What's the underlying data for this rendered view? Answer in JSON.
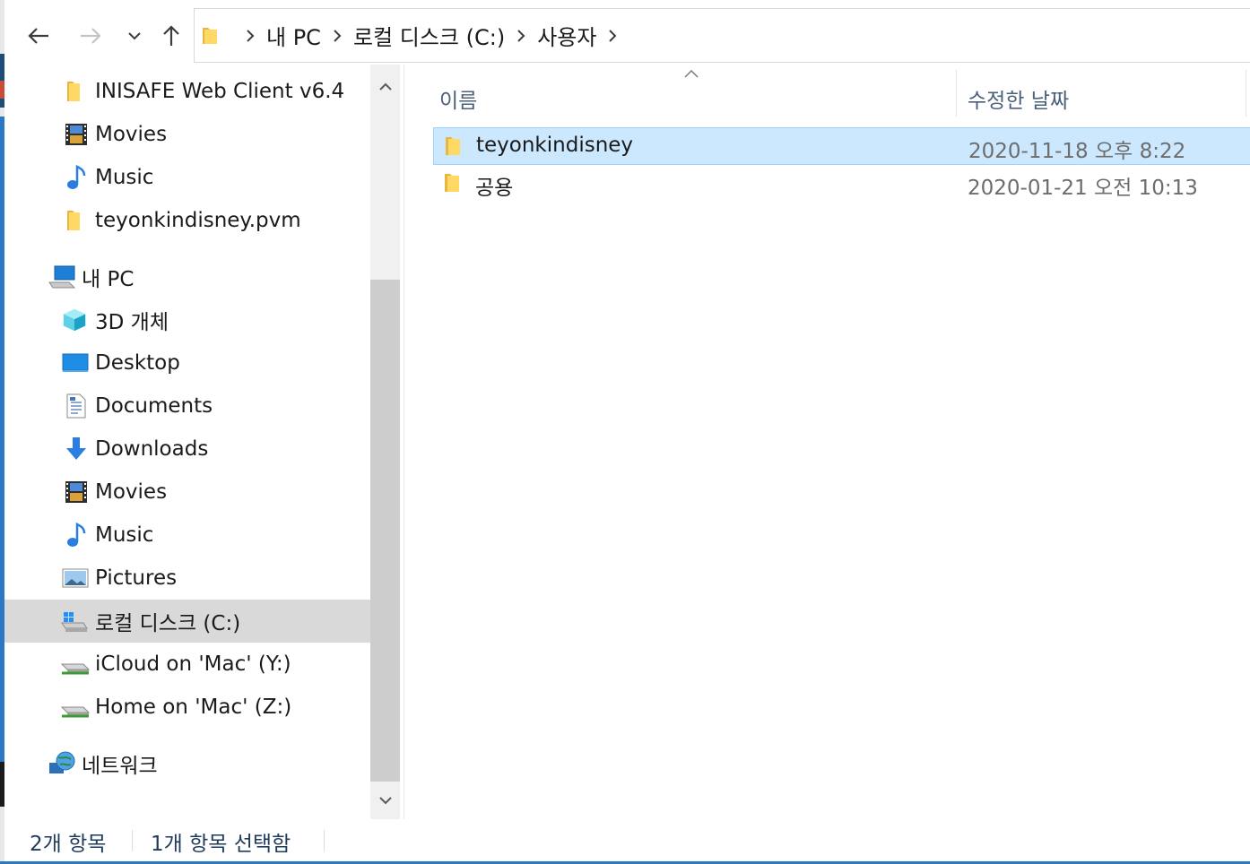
{
  "window": {
    "accent_color": "#2a78c6",
    "selection_color": "#cce8ff"
  },
  "toolbar": {
    "back_icon": "back-arrow-icon",
    "forward_icon": "forward-arrow-icon",
    "recent_icon": "chevron-down-icon",
    "up_icon": "up-arrow-icon"
  },
  "address": {
    "crumbs": [
      "내 PC",
      "로컬 디스크 (C:)",
      "사용자"
    ]
  },
  "nav_pane": {
    "items": [
      {
        "label": "INISAFE Web Client v6.4",
        "icon": "folder-icon"
      },
      {
        "label": "Movies",
        "icon": "film-icon"
      },
      {
        "label": "Music",
        "icon": "music-note-icon"
      },
      {
        "label": "teyonkindisney.pvm",
        "icon": "folder-icon"
      },
      {
        "label": "내 PC",
        "icon": "computer-icon"
      },
      {
        "label": "3D 개체",
        "icon": "cube-3d-icon"
      },
      {
        "label": "Desktop",
        "icon": "desktop-icon"
      },
      {
        "label": "Documents",
        "icon": "document-icon"
      },
      {
        "label": "Downloads",
        "icon": "download-arrow-icon"
      },
      {
        "label": "Movies",
        "icon": "film-icon"
      },
      {
        "label": "Music",
        "icon": "music-note-icon"
      },
      {
        "label": "Pictures",
        "icon": "picture-icon"
      },
      {
        "label": "로컬 디스크 (C:)",
        "icon": "windows-drive-icon"
      },
      {
        "label": "iCloud on 'Mac' (Y:)",
        "icon": "network-drive-icon"
      },
      {
        "label": "Home on 'Mac' (Z:)",
        "icon": "network-drive-icon"
      },
      {
        "label": "네트워크",
        "icon": "network-globe-icon"
      }
    ]
  },
  "content": {
    "columns": {
      "name": "이름",
      "date_modified": "수정한 날짜"
    },
    "files": [
      {
        "name": "teyonkindisney",
        "date": "2020-11-18 오후 8:22",
        "icon": "folder-icon"
      },
      {
        "name": "공용",
        "date": "2020-01-21 오전 10:13",
        "icon": "folder-icon"
      }
    ]
  },
  "status": {
    "item_count": "2개 항목",
    "selected_count": "1개 항목 선택함"
  }
}
